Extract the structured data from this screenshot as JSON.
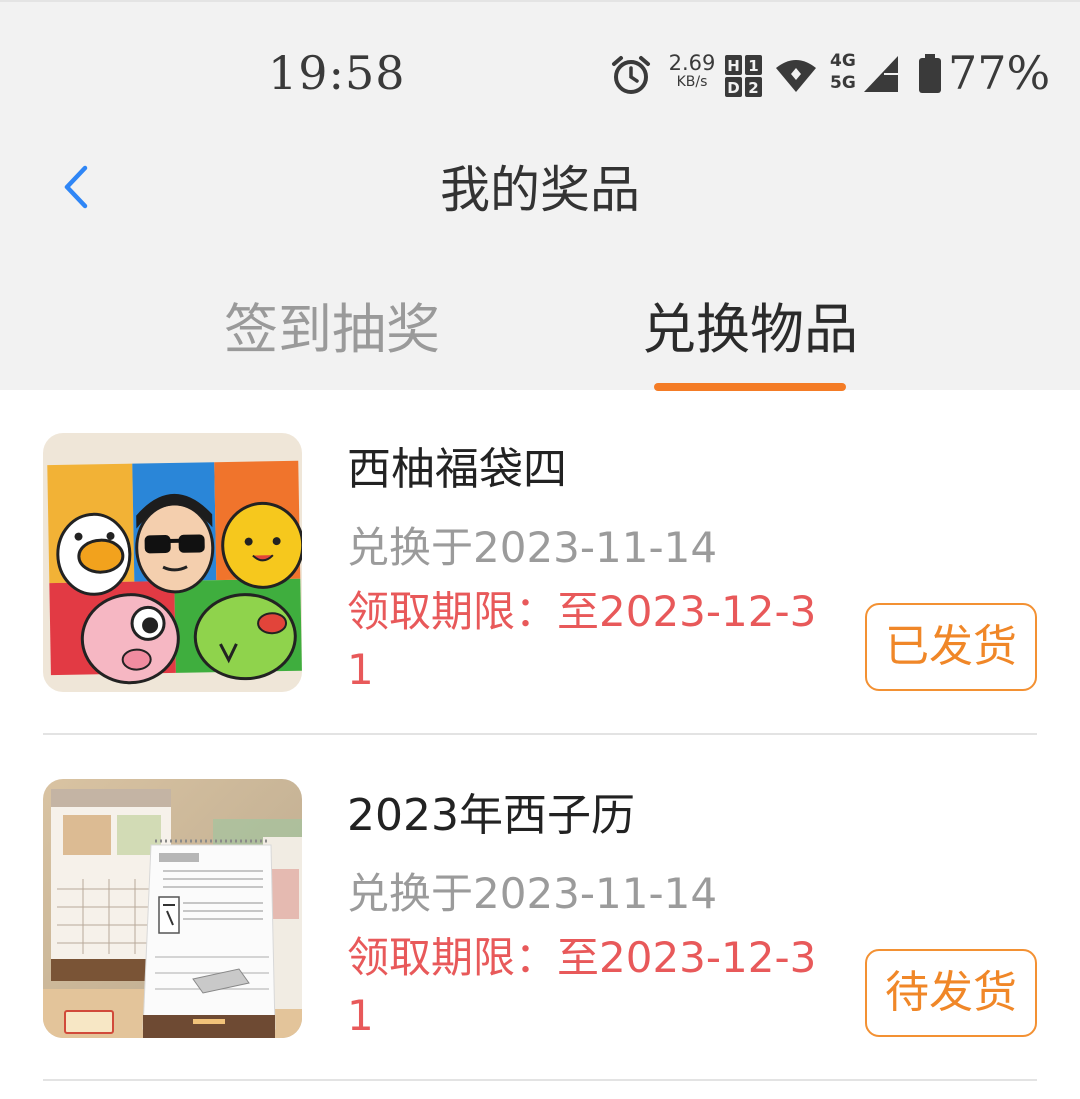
{
  "status_bar": {
    "time": "19:58",
    "net_speed_value": "2.69",
    "net_speed_unit": "KB/s",
    "sim_labels": "H1 H2",
    "net_type_top": "4G",
    "net_type_bottom": "5G",
    "battery": "77%"
  },
  "header": {
    "title": "我的奖品",
    "back_icon": "chevron-left-icon"
  },
  "tabs": [
    {
      "label": "签到抽奖",
      "active": false
    },
    {
      "label": "兑换物品",
      "active": true
    }
  ],
  "colors": {
    "accent": "#f47c26",
    "deadline": "#e8595a",
    "header_bg": "#f2f2f2"
  },
  "prizes": [
    {
      "name": "西柚福袋四",
      "exchange_date": "兑换于2023-11-14",
      "deadline": "领取期限：至2023-12-31",
      "status": "已发货",
      "image": "cartoon-notebooks-image"
    },
    {
      "name": "2023年西子历",
      "exchange_date": "兑换于2023-11-14",
      "deadline": "领取期限：至2023-12-31",
      "status": "待发货",
      "image": "desk-calendar-image"
    }
  ]
}
